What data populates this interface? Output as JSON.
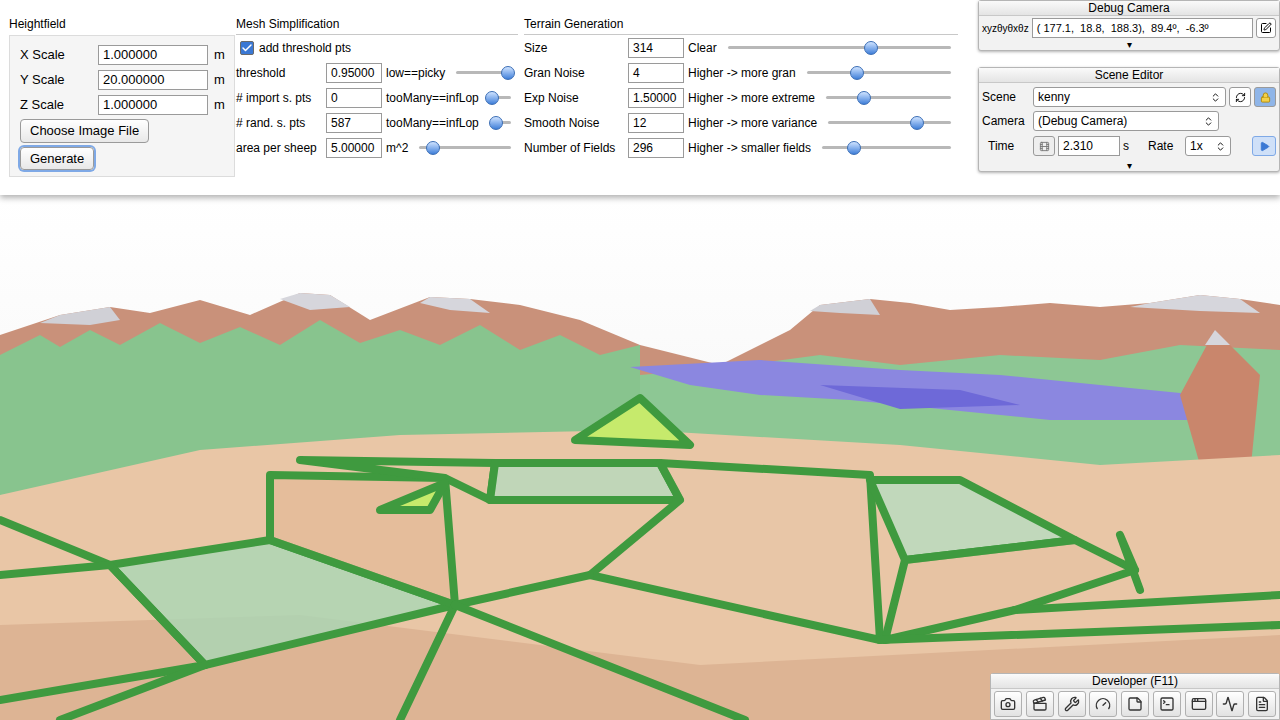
{
  "heightfield": {
    "title": "Heightfield",
    "rows": [
      {
        "label": "X Scale",
        "value": "1.000000",
        "unit": "m"
      },
      {
        "label": "Y Scale",
        "value": "20.000000",
        "unit": "m"
      },
      {
        "label": "Z Scale",
        "value": "1.000000",
        "unit": "m"
      }
    ],
    "buttons": [
      {
        "label": "Choose Image File",
        "focused": false
      },
      {
        "label": "Generate",
        "focused": true
      }
    ]
  },
  "mesh": {
    "title": "Mesh Simplification",
    "checkbox": {
      "label": "add threshold pts",
      "checked": true
    },
    "rows": [
      {
        "label": "threshold",
        "value": "0.95000",
        "hint": "low==picky",
        "level": 0.95
      },
      {
        "label": "# import s. pts",
        "value": "0",
        "hint": "tooMany==infLop",
        "level": 0.1
      },
      {
        "label": "# rand. s. pts",
        "value": "587",
        "hint": "tooMany==infLop",
        "level": 0.3
      },
      {
        "label": "area per sheep",
        "value": "5.00000",
        "hint": "m^2",
        "level": 0.15
      }
    ]
  },
  "terrain": {
    "title": "Terrain Generation",
    "rows": [
      {
        "label": "Size",
        "value": "314",
        "hint": "Clear",
        "level": 0.64
      },
      {
        "label": "Gran Noise",
        "value": "4",
        "hint": "Higher -> more gran",
        "level": 0.35
      },
      {
        "label": "Exp Noise",
        "value": "1.50000",
        "hint": "Higher -> more extreme",
        "level": 0.3
      },
      {
        "label": "Smooth Noise",
        "value": "12",
        "hint": "Higher -> more variance",
        "level": 0.72
      },
      {
        "label": "Number of Fields",
        "value": "296",
        "hint": "Higher -> smaller fields",
        "level": 0.25
      }
    ]
  },
  "debug_camera": {
    "title": "Debug Camera",
    "label": "xyzθyθxθz",
    "value": "( 177.1,  18.8,  188.3),  89.4º,  -6.3º",
    "toggle": "▾"
  },
  "scene_editor": {
    "title": "Scene Editor",
    "scene_label": "Scene",
    "scene": "kenny",
    "locked": true,
    "camera_label": "Camera",
    "camera": "(Debug Camera)",
    "time_label": "Time",
    "time": "2.310",
    "time_unit": "s",
    "rate_label": "Rate",
    "rate": "1x",
    "toggle": "▾"
  },
  "developer": {
    "title": "Developer (F11)"
  }
}
